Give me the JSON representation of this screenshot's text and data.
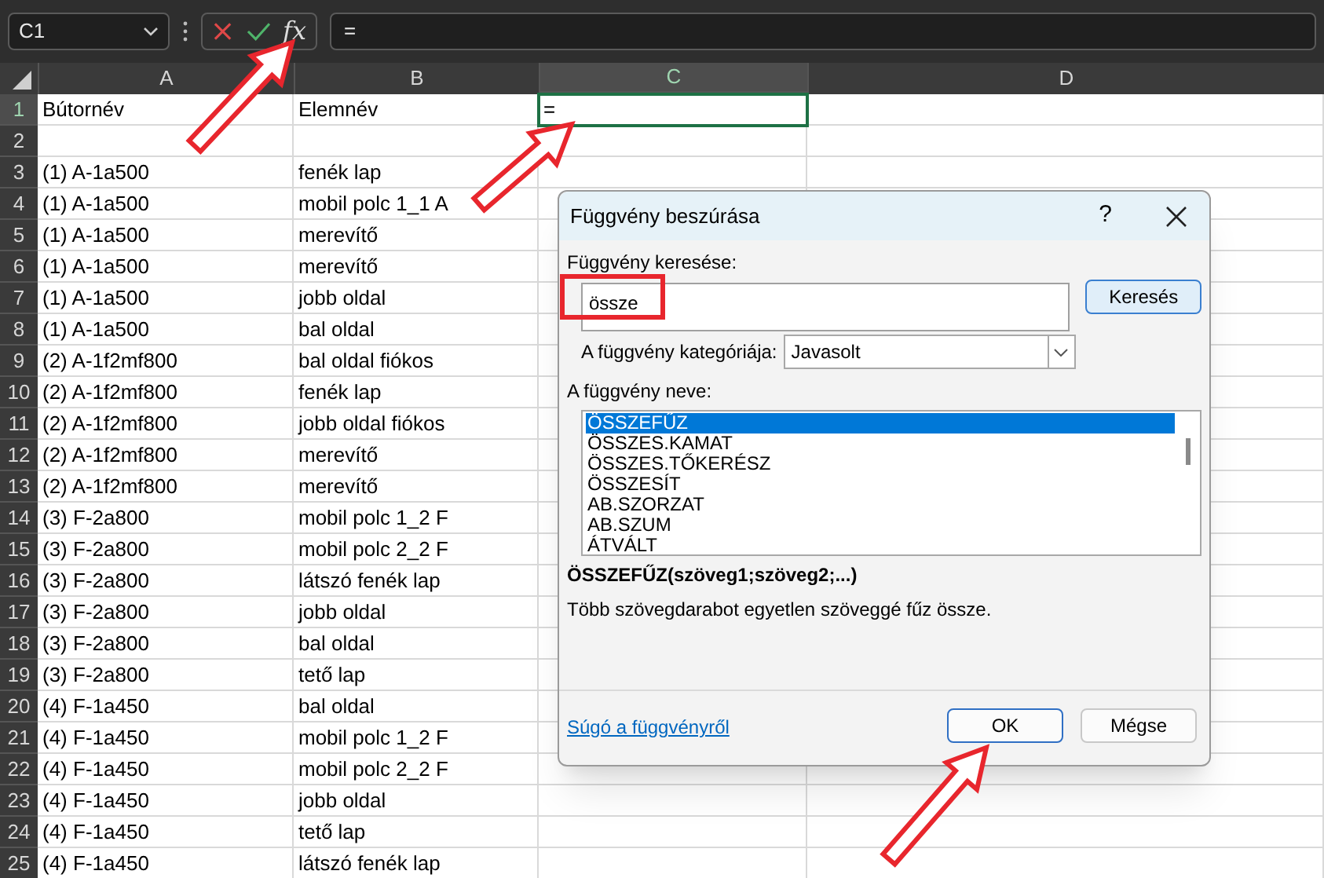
{
  "formula_bar": {
    "name_box": "C1",
    "fx": "fx",
    "formula": "="
  },
  "columns": [
    {
      "label": "A",
      "selected": false
    },
    {
      "label": "B",
      "selected": false
    },
    {
      "label": "C",
      "selected": true
    },
    {
      "label": "D",
      "selected": false
    }
  ],
  "rows": [
    {
      "number": "1",
      "selected": true,
      "cells": [
        "Bútornév",
        "Elemnév",
        "="
      ]
    },
    {
      "number": "2",
      "selected": false,
      "cells": [
        "",
        "",
        ""
      ]
    },
    {
      "number": "3",
      "selected": false,
      "cells": [
        "(1) A-1a500",
        "fenék lap",
        ""
      ]
    },
    {
      "number": "4",
      "selected": false,
      "cells": [
        "(1) A-1a500",
        "mobil polc 1_1 A",
        ""
      ]
    },
    {
      "number": "5",
      "selected": false,
      "cells": [
        "(1) A-1a500",
        "merevítő",
        ""
      ]
    },
    {
      "number": "6",
      "selected": false,
      "cells": [
        "(1) A-1a500",
        "merevítő",
        ""
      ]
    },
    {
      "number": "7",
      "selected": false,
      "cells": [
        "(1) A-1a500",
        "jobb oldal",
        ""
      ]
    },
    {
      "number": "8",
      "selected": false,
      "cells": [
        "(1) A-1a500",
        "bal oldal",
        ""
      ]
    },
    {
      "number": "9",
      "selected": false,
      "cells": [
        "(2) A-1f2mf800",
        "bal oldal fiókos",
        ""
      ]
    },
    {
      "number": "10",
      "selected": false,
      "cells": [
        "(2) A-1f2mf800",
        "fenék lap",
        ""
      ]
    },
    {
      "number": "11",
      "selected": false,
      "cells": [
        "(2) A-1f2mf800",
        "jobb oldal fiókos",
        ""
      ]
    },
    {
      "number": "12",
      "selected": false,
      "cells": [
        "(2) A-1f2mf800",
        "merevítő",
        ""
      ]
    },
    {
      "number": "13",
      "selected": false,
      "cells": [
        "(2) A-1f2mf800",
        "merevítő",
        ""
      ]
    },
    {
      "number": "14",
      "selected": false,
      "cells": [
        "(3) F-2a800",
        "mobil polc 1_2 F",
        ""
      ]
    },
    {
      "number": "15",
      "selected": false,
      "cells": [
        "(3) F-2a800",
        "mobil polc 2_2 F",
        ""
      ]
    },
    {
      "number": "16",
      "selected": false,
      "cells": [
        "(3) F-2a800",
        "látszó fenék lap",
        ""
      ]
    },
    {
      "number": "17",
      "selected": false,
      "cells": [
        "(3) F-2a800",
        "jobb oldal",
        ""
      ]
    },
    {
      "number": "18",
      "selected": false,
      "cells": [
        "(3) F-2a800",
        "bal oldal",
        ""
      ]
    },
    {
      "number": "19",
      "selected": false,
      "cells": [
        "(3) F-2a800",
        "tető lap",
        ""
      ]
    },
    {
      "number": "20",
      "selected": false,
      "cells": [
        "(4) F-1a450",
        "bal oldal",
        ""
      ]
    },
    {
      "number": "21",
      "selected": false,
      "cells": [
        "(4) F-1a450",
        "mobil polc 1_2 F",
        ""
      ]
    },
    {
      "number": "22",
      "selected": false,
      "cells": [
        "(4) F-1a450",
        "mobil polc 2_2 F",
        ""
      ]
    },
    {
      "number": "23",
      "selected": false,
      "cells": [
        "(4) F-1a450",
        "jobb oldal",
        ""
      ]
    },
    {
      "number": "24",
      "selected": false,
      "cells": [
        "(4) F-1a450",
        "tető lap",
        ""
      ]
    },
    {
      "number": "25",
      "selected": false,
      "cells": [
        "(4) F-1a450",
        "látszó fenék lap",
        ""
      ]
    }
  ],
  "dialog": {
    "title": "Függvény beszúrása",
    "help": "?",
    "search_label": "Függvény keresése:",
    "search_value": "össze",
    "search_button": "Keresés",
    "category_label": "A függvény kategóriája:",
    "category_value": "Javasolt",
    "list_label": "A függvény neve:",
    "functions": [
      {
        "label": "ÖSSZEFŰZ",
        "selected": true
      },
      {
        "label": "ÖSSZES.KAMAT",
        "selected": false
      },
      {
        "label": "ÖSSZES.TŐKERÉSZ",
        "selected": false
      },
      {
        "label": "ÖSSZESÍT",
        "selected": false
      },
      {
        "label": "AB.SZORZAT",
        "selected": false
      },
      {
        "label": "AB.SZUM",
        "selected": false
      },
      {
        "label": "ÁTVÁLT",
        "selected": false
      }
    ],
    "signature": "ÖSSZEFŰZ(szöveg1;szöveg2;...)",
    "description": "Több szövegdarabot egyetlen szöveggé fűz össze.",
    "help_link": "Súgó a függvényről",
    "ok": "OK",
    "cancel": "Mégse"
  }
}
